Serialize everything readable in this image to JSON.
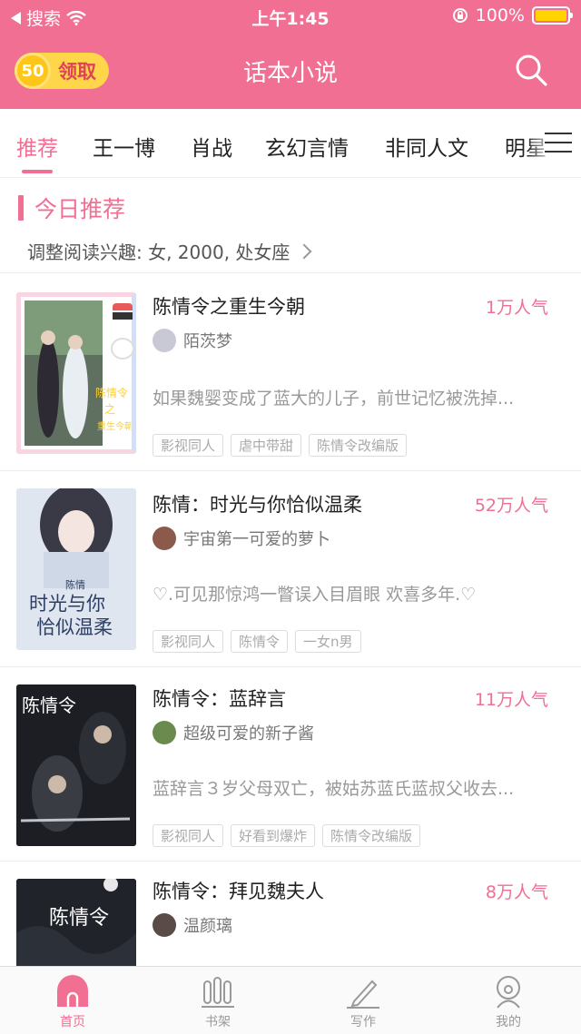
{
  "status_bar": {
    "back_label": "搜索",
    "time": "上午1:45",
    "battery": "100%"
  },
  "header": {
    "coin_amount": "50",
    "claim_label": "领取",
    "title": "话本小说"
  },
  "tabs": [
    {
      "label": "推荐",
      "active": true
    },
    {
      "label": "王一博"
    },
    {
      "label": "肖战"
    },
    {
      "label": "玄幻言情"
    },
    {
      "label": "非同人文"
    },
    {
      "label": "明星"
    }
  ],
  "section": {
    "title": "今日推荐",
    "interest": "调整阅读兴趣: 女, 2000, 处女座"
  },
  "books": [
    {
      "title": "陈情令之重生今朝",
      "popularity": "1万人气",
      "author": "陌茨梦",
      "description": "如果魏婴变成了蓝大的儿子，前世记忆被洗掉...",
      "tags": [
        "影视同人",
        "虐中带甜",
        "陈情令改编版"
      ],
      "cover_text": "陈情令之重生今朝"
    },
    {
      "title": "陈情：时光与你恰似温柔",
      "popularity": "52万人气",
      "author": "宇宙第一可爱的萝卜",
      "description": "♡.可见那惊鸿一瞥误入目眉眼 欢喜多年.♡",
      "tags": [
        "影视同人",
        "陈情令",
        "一女n男"
      ],
      "cover_text": "时光与你恰似温柔"
    },
    {
      "title": "陈情令：蓝辞言",
      "popularity": "11万人气",
      "author": "超级可爱的新子酱",
      "description": "蓝辞言３岁父母双亡，被姑苏蓝氏蓝叔父收去...",
      "tags": [
        "影视同人",
        "好看到爆炸",
        "陈情令改编版"
      ],
      "cover_text": "陈情令"
    },
    {
      "title": "陈情令：拜见魏夫人",
      "popularity": "8万人气",
      "author": "温颜璃",
      "description": "",
      "tags": [],
      "cover_text": "陈情令"
    }
  ],
  "bottom_nav": [
    {
      "label": "首页",
      "icon": "home-icon",
      "active": true
    },
    {
      "label": "书架",
      "icon": "bookshelf-icon"
    },
    {
      "label": "写作",
      "icon": "pen-icon"
    },
    {
      "label": "我的",
      "icon": "profile-icon"
    }
  ],
  "colors": {
    "brand_pink": "#f06f93",
    "coin_yellow": "#ffd54a"
  }
}
